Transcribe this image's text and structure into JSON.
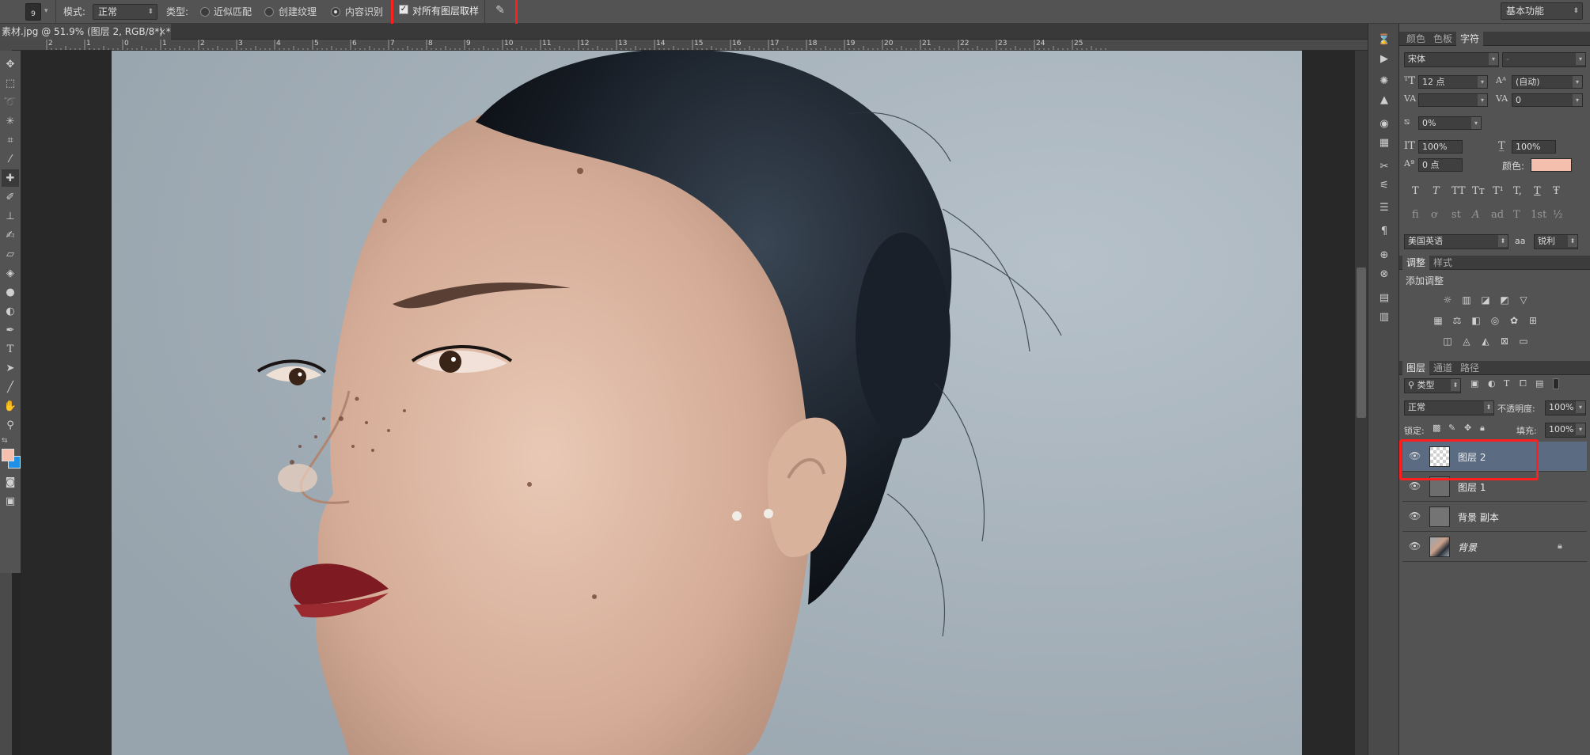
{
  "option_bar": {
    "brush_size": "9",
    "mode_label": "模式:",
    "mode_value": "正常",
    "type_label": "类型:",
    "type_options": [
      "近似匹配",
      "创建纹理",
      "内容识别"
    ],
    "type_selected": "内容识别",
    "sample_all_layers_label": "对所有图层取样",
    "sample_all_layers_checked": true,
    "workspace": "基本功能"
  },
  "document": {
    "tab_title": "素材.jpg @ 51.9% (图层 2, RGB/8*) *",
    "ruler_ticks": [
      "2",
      "1",
      "0",
      "1",
      "2",
      "3",
      "4",
      "5",
      "6",
      "7",
      "8",
      "9",
      "10",
      "11",
      "12",
      "13",
      "14",
      "15",
      "16",
      "17",
      "18",
      "19",
      "20",
      "21",
      "22",
      "23",
      "24",
      "25"
    ]
  },
  "character_panel": {
    "tabs": [
      "颜色",
      "色板",
      "字符"
    ],
    "active_tab": "字符",
    "font_family": "宋体",
    "font_style": "-",
    "font_size": "12 点",
    "leading": "(自动)",
    "kerning": "",
    "tracking": "0",
    "scale_percent": "0%",
    "vertical_scale": "100%",
    "horizontal_scale": "100%",
    "baseline_shift": "0 点",
    "color_label": "颜色:",
    "text_color": "#f5bfad",
    "style_buttons": [
      "T",
      "T",
      "TT",
      "Tт",
      "T¹",
      "T,",
      "T",
      "Ŧ"
    ],
    "opentype_buttons": [
      "fi",
      "ơ",
      "st",
      "A",
      "ad",
      "T",
      "1st",
      "½"
    ],
    "language": "美国英语",
    "aa_icon": "aa",
    "antialias": "锐利"
  },
  "adjustments_panel": {
    "tabs": [
      "调整",
      "样式"
    ],
    "active_tab": "调整",
    "title": "添加调整",
    "icons": [
      "brightness-contrast",
      "levels",
      "curves",
      "exposure",
      "vibrance",
      "hue-saturation",
      "color-balance",
      "black-white",
      "photo-filter",
      "channel-mixer",
      "color-lookup",
      "invert",
      "posterize",
      "threshold",
      "selective-color",
      "gradient-map"
    ]
  },
  "layers_panel": {
    "tabs": [
      "图层",
      "通道",
      "路径"
    ],
    "active_tab": "图层",
    "filter_kind": "类型",
    "blend_mode": "正常",
    "opacity_label": "不透明度:",
    "opacity": "100%",
    "lock_label": "锁定:",
    "fill_label": "填充:",
    "fill": "100%",
    "layers": [
      {
        "name": "图层 2",
        "selected": true,
        "thumb": "transparent"
      },
      {
        "name": "图层 1",
        "selected": false,
        "thumb": "gray"
      },
      {
        "name": "背景 副本",
        "selected": false,
        "thumb": "gray"
      },
      {
        "name": "背景",
        "selected": false,
        "thumb": "photo",
        "locked": true
      }
    ]
  },
  "colors": {
    "foreground": "#f5bfad",
    "background": "#1e90e6",
    "highlight": "#ff1f1f"
  }
}
